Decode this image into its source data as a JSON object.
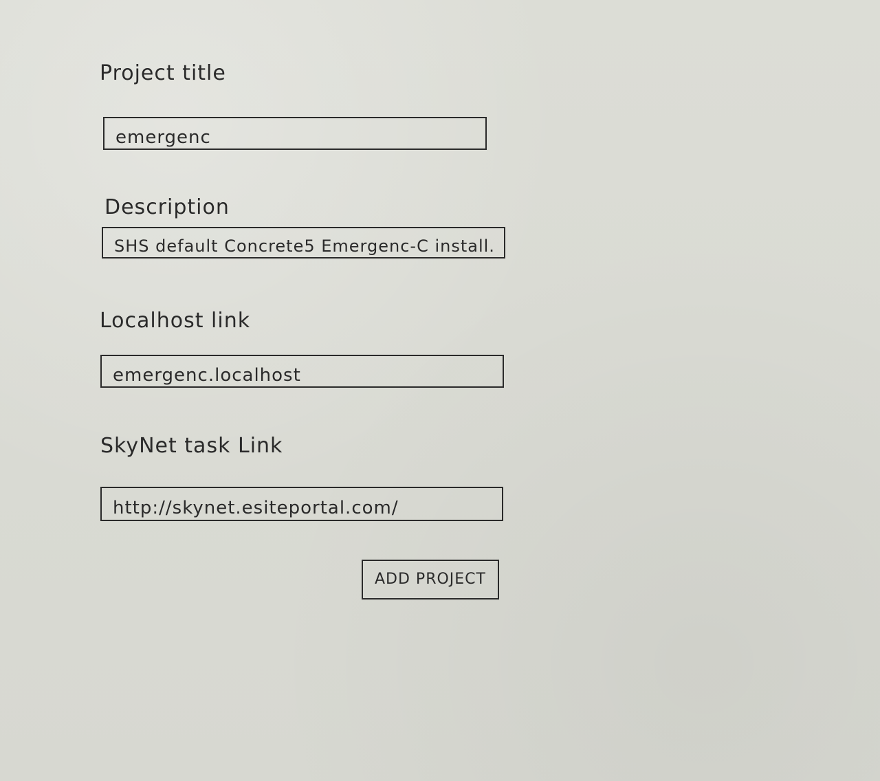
{
  "form": {
    "project_title_label": "Project title",
    "project_title_value": "emergenc",
    "description_label": "Description",
    "description_value": "SHS default Concrete5 Emergenc-C install.",
    "localhost_link_label": "Localhost link",
    "localhost_link_value": "emergenc.localhost",
    "skynet_task_link_label": "SkyNet task Link",
    "skynet_task_link_value": "http://skynet.esiteportal.com/"
  },
  "actions": {
    "add_project_label": "ADD PROJECT"
  },
  "theme": {
    "paper_color": "#d9dad3",
    "ink_color": "#2a2a2a"
  }
}
